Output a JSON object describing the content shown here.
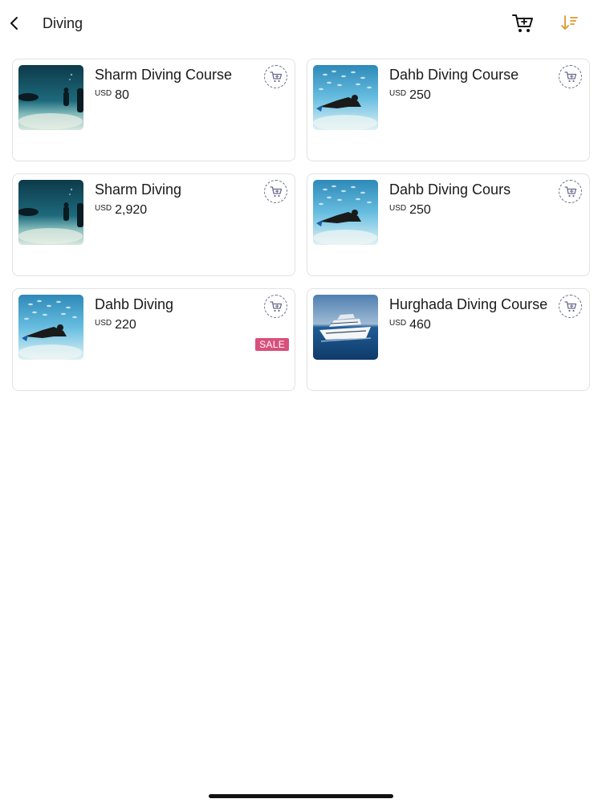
{
  "header": {
    "title": "Diving",
    "icons": {
      "back": "chevron-left-icon",
      "cart": "cart-icon",
      "sort": "sort-icon"
    },
    "colors": {
      "sort_accent": "#e0962a"
    }
  },
  "products": [
    {
      "title": "Sharm Diving Course",
      "currency": "USD",
      "amount": "80",
      "image": "divers-dark-water",
      "sale": null
    },
    {
      "title": "Dahb Diving Course",
      "currency": "USD",
      "amount": "250",
      "image": "diver-with-fish",
      "sale": null
    },
    {
      "title": "Sharm Diving",
      "currency": "USD",
      "amount": "2,920",
      "image": "divers-dark-water",
      "sale": null
    },
    {
      "title": "Dahb Diving Cours",
      "currency": "USD",
      "amount": "250",
      "image": "diver-with-fish",
      "sale": null
    },
    {
      "title": "Dahb Diving",
      "currency": "USD",
      "amount": "220",
      "image": "diver-with-fish",
      "sale": "SALE"
    },
    {
      "title": "Hurghada Diving Course",
      "currency": "USD",
      "amount": "460",
      "image": "yacht-at-sea",
      "sale": null
    }
  ],
  "colors": {
    "sale_badge": "#d9507a",
    "cart_icon": "#6b6b8e"
  }
}
